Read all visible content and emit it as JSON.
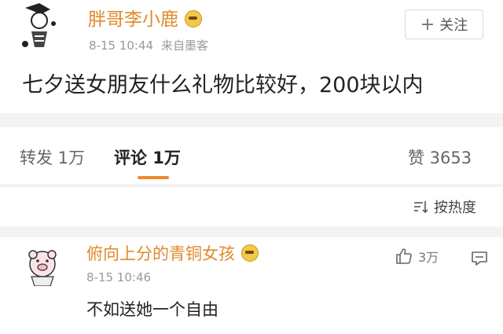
{
  "post": {
    "author": "胖哥李小鹿",
    "time": "8-15 10:44",
    "source": "来自墨客",
    "follow_label": "关注",
    "text": "七夕送女朋友什么礼物比较好，200块以内"
  },
  "tabs": {
    "repost": "转发 1万",
    "comment": "评论 1万",
    "likes": "赞 3653"
  },
  "sort_label": "按热度",
  "comment": {
    "author": "俯向上分的青铜女孩",
    "time": "8-15 10:46",
    "text": "不如送她一个自由",
    "like_count": "3万"
  },
  "colors": {
    "username": "#e08a2a",
    "accent_underline": "#ef8a2e"
  }
}
